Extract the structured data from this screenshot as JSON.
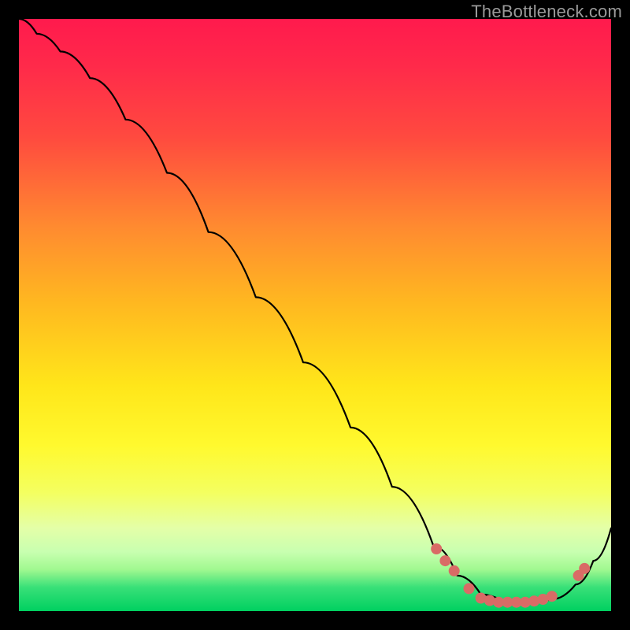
{
  "watermark": "TheBottleneck.com",
  "colors": {
    "marker": "#d96b66",
    "line": "#000000"
  },
  "chart_data": {
    "type": "line",
    "title": "",
    "xlabel": "",
    "ylabel": "",
    "xlim": [
      0,
      1
    ],
    "ylim": [
      0,
      1
    ],
    "grid": false,
    "legend": false,
    "series": [
      {
        "name": "curve",
        "x": [
          0.0,
          0.03,
          0.07,
          0.12,
          0.18,
          0.25,
          0.32,
          0.4,
          0.48,
          0.56,
          0.63,
          0.7,
          0.74,
          0.78,
          0.82,
          0.86,
          0.9,
          0.94,
          0.97,
          1.0
        ],
        "y": [
          1.0,
          0.975,
          0.945,
          0.9,
          0.83,
          0.74,
          0.64,
          0.53,
          0.42,
          0.31,
          0.21,
          0.11,
          0.06,
          0.028,
          0.015,
          0.015,
          0.02,
          0.045,
          0.085,
          0.14
        ]
      }
    ],
    "markers": {
      "name": "highlighted-points",
      "x": [
        0.705,
        0.72,
        0.735,
        0.76,
        0.78,
        0.795,
        0.81,
        0.825,
        0.84,
        0.855,
        0.87,
        0.885,
        0.9,
        0.945,
        0.955
      ],
      "y": [
        0.105,
        0.085,
        0.068,
        0.038,
        0.022,
        0.018,
        0.015,
        0.015,
        0.015,
        0.015,
        0.017,
        0.02,
        0.025,
        0.06,
        0.072
      ]
    }
  }
}
